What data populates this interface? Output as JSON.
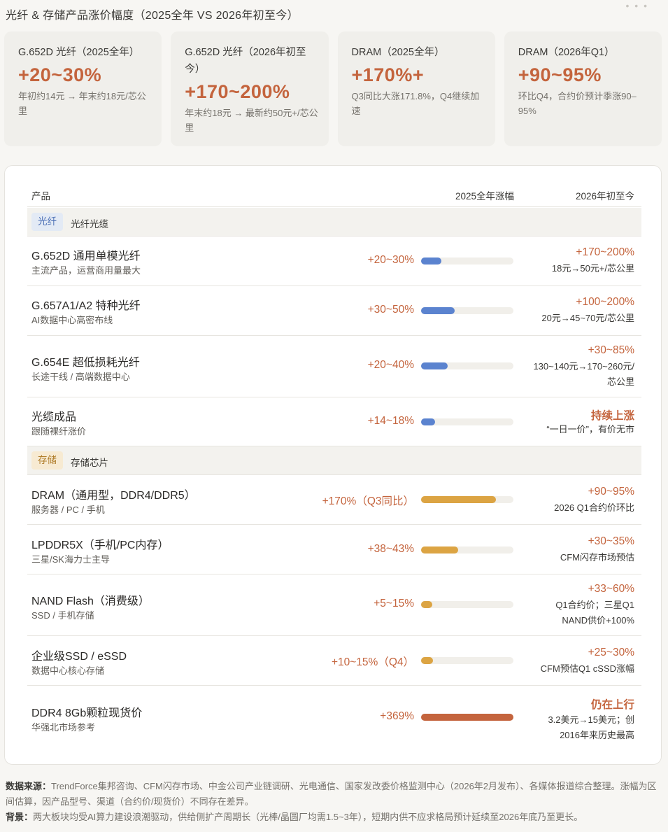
{
  "page_title": "光纤 & 存储产品涨价幅度（2025全年 VS 2026年初至今）",
  "more_dots": "• • •",
  "cards": [
    {
      "title": "G.652D 光纤（2025全年）",
      "value": "+20~30%",
      "desc": "年初约14元 → 年末约18元/芯公里"
    },
    {
      "title": "G.652D 光纤（2026年初至今）",
      "value": "+170~200%",
      "desc": "年末约18元 → 最新约50元+/芯公里"
    },
    {
      "title": "DRAM（2025全年）",
      "value": "+170%+",
      "desc": "Q3同比大涨171.8%，Q4继续加速"
    },
    {
      "title": "DRAM（2026年Q1）",
      "value": "+90~95%",
      "desc": "环比Q4，合约价预计季涨90–95%"
    }
  ],
  "table": {
    "headers": {
      "product": "产品",
      "y2025": "2025全年涨幅",
      "y2026": "2026年初至今"
    },
    "sections": [
      {
        "tag": "光纤",
        "label": "光纤光缆",
        "rows": [
          {
            "name": "G.652D 通用单模光纤",
            "sub": "主流产品，运营商用量最大",
            "pct": "+20~30%",
            "bar": 0.22,
            "r_main": "+170~200%",
            "r_sub": "18元→50元+/芯公里"
          },
          {
            "name": "G.657A1/A2 特种光纤",
            "sub": "AI数据中心高密布线",
            "pct": "+30~50%",
            "bar": 0.36,
            "r_main": "+100~200%",
            "r_sub": "20元→45~70元/芯公里"
          },
          {
            "name": "G.654E 超低损耗光纤",
            "sub": "长途干线 / 高端数据中心",
            "pct": "+20~40%",
            "bar": 0.29,
            "r_main": "+30~85%",
            "r_sub": "130~140元→170~260元/芯公里"
          },
          {
            "name": "光缆成品",
            "sub": "跟随裸纤涨价",
            "pct": "+14~18%",
            "bar": 0.15,
            "r_main": "持续上涨",
            "r_sub": "“一日一价”，有价无市"
          }
        ]
      },
      {
        "tag": "存储",
        "label": "存储芯片",
        "rows": [
          {
            "name": "DRAM（通用型，DDR4/DDR5）",
            "sub": "服务器 / PC / 手机",
            "pct": "+170%（Q3同比）",
            "bar": 0.81,
            "r_main": "+90~95%",
            "r_sub": "2026 Q1合约价环比"
          },
          {
            "name": "LPDDR5X（手机/PC内存）",
            "sub": "三星/SK海力士主导",
            "pct": "+38~43%",
            "bar": 0.4,
            "r_main": "+30~35%",
            "r_sub": "CFM闪存市场预估"
          },
          {
            "name": "NAND Flash（消费级）",
            "sub": "SSD / 手机存储",
            "pct": "+5~15%",
            "bar": 0.12,
            "r_main": "+33~60%",
            "r_sub": "Q1合约价；三星Q1 NAND供价+100%"
          },
          {
            "name": "企业级SSD / eSSD",
            "sub": "数据中心核心存储",
            "pct": "+10~15%（Q4）",
            "bar": 0.13,
            "r_main": "+25~30%",
            "r_sub": "CFM预估Q1 cSSD涨幅"
          },
          {
            "name": "DDR4 8Gb颗粒现货价",
            "sub": "华强北市场参考",
            "pct": "+369%",
            "bar": 1.0,
            "r_main": "仍在上行",
            "r_sub": "3.2美元→15美元；创2016年来历史最高"
          }
        ]
      }
    ]
  },
  "footnotes": {
    "source_label": "数据来源：",
    "source_text": "TrendForce集邦咨询、CFM闪存市场、中金公司产业链调研、光电通信、国家发改委价格监测中心（2026年2月发布）、各媒体报道综合整理。涨幅为区间估算，因产品型号、渠道（合约价/现货价）不同存在差异。",
    "background_label": "背景：",
    "background_text": "两大板块均受AI算力建设浪潮驱动，供给侧扩产周期长（光棒/晶圆厂均需1.5~3年），短期内供不应求格局预计延续至2026年底乃至更长。"
  },
  "colors": {
    "accent": "#c4643d",
    "bar_blue": "#5b83cf",
    "bar_amber": "#dca443",
    "bar_rust": "#c4643d"
  }
}
